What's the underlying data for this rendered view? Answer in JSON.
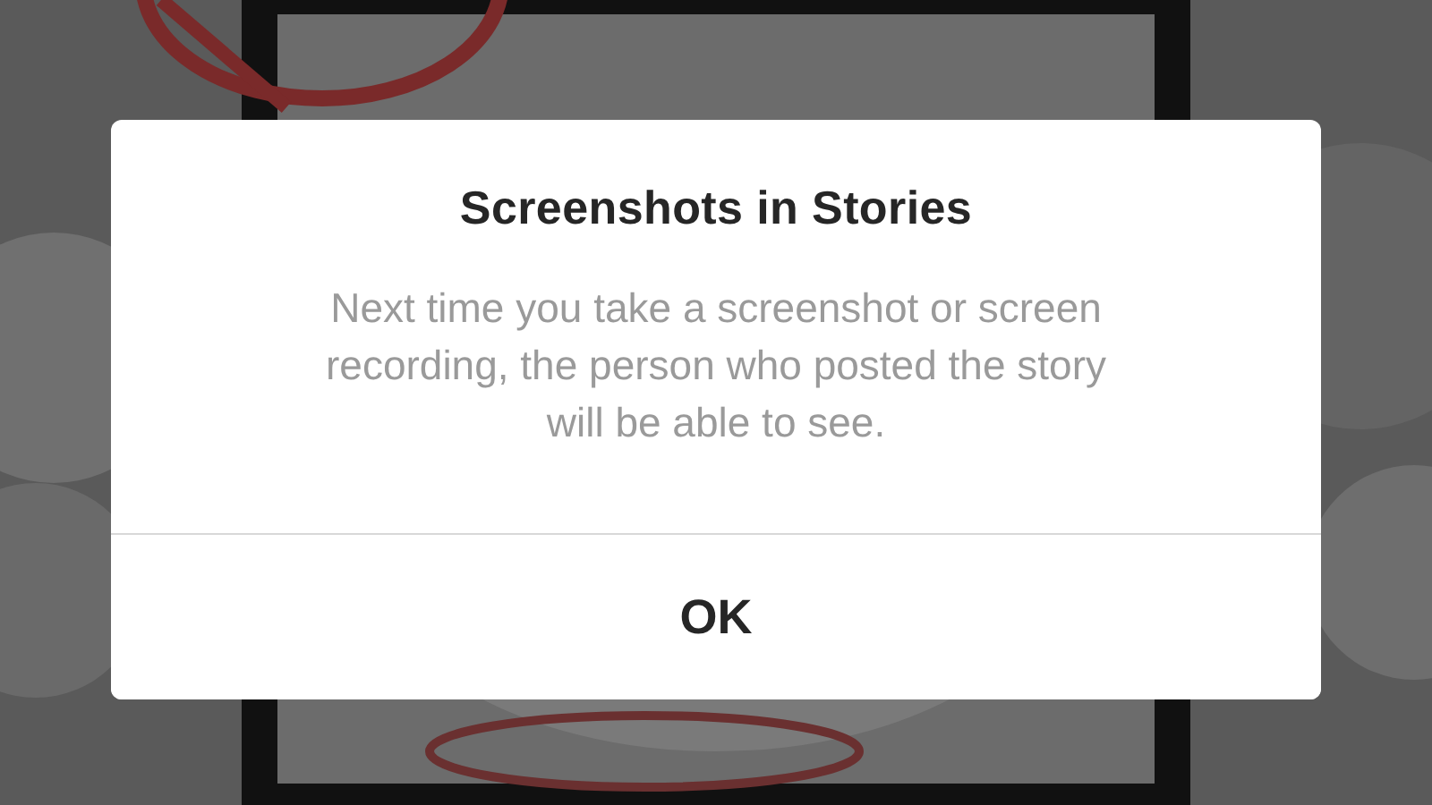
{
  "dialog": {
    "title": "Screenshots in Stories",
    "message": "Next time you take a screenshot or screen recording, the person who posted the story will be able to see.",
    "buttons": [
      "OK"
    ]
  }
}
